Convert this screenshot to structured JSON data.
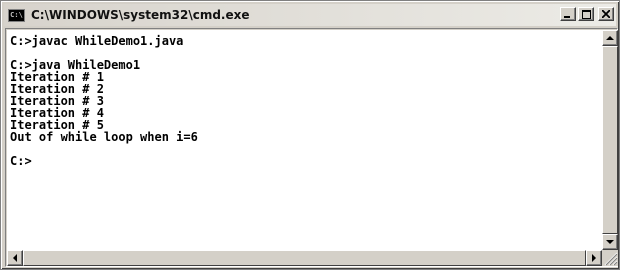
{
  "window": {
    "title": "C:\\WINDOWS\\system32\\cmd.exe",
    "icon_label": "C:\\",
    "icon": "console-icon"
  },
  "controls": {
    "minimize_icon": "minimize-icon",
    "maximize_icon": "maximize-icon",
    "close_icon": "close-icon"
  },
  "console": {
    "lines": [
      "C:>javac WhileDemo1.java",
      "",
      "C:>java WhileDemo1",
      "Iteration # 1",
      "Iteration # 2",
      "Iteration # 3",
      "Iteration # 4",
      "Iteration # 5",
      "Out of while loop when i=6",
      "",
      "C:>"
    ]
  },
  "scrollbars": {
    "up_icon": "arrow-up-icon",
    "down_icon": "arrow-down-icon",
    "left_icon": "arrow-left-icon",
    "right_icon": "arrow-right-icon",
    "grip_icon": "resize-grip-icon"
  }
}
